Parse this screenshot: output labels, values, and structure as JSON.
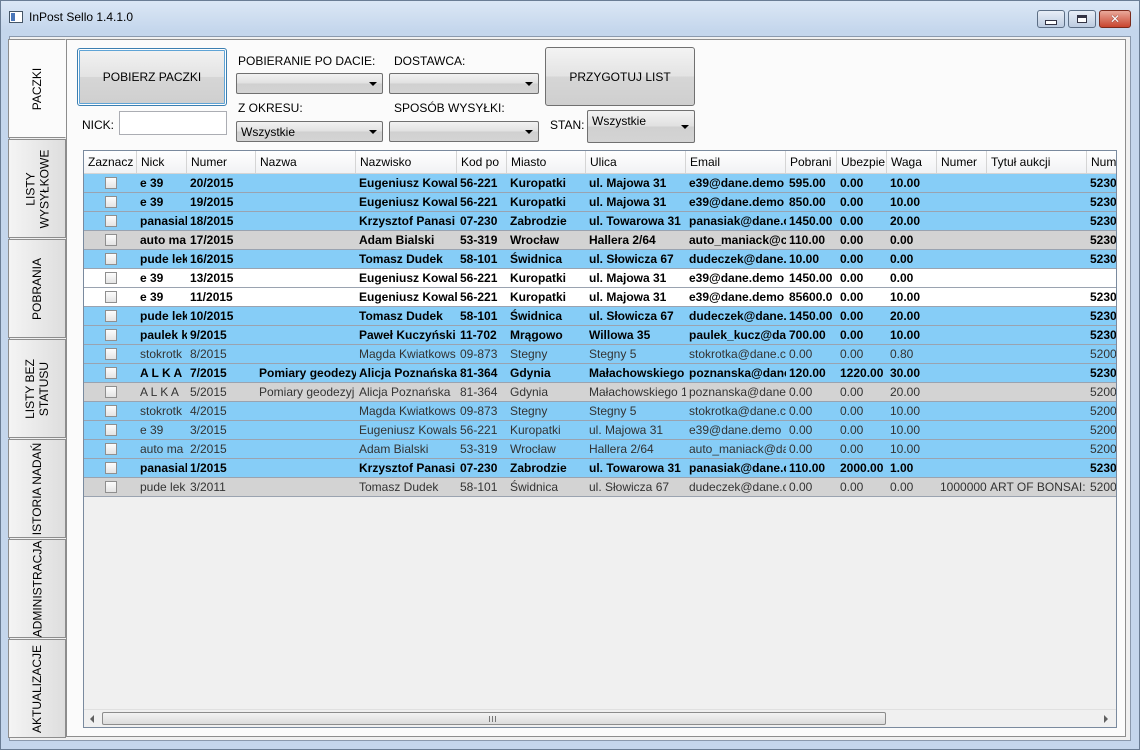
{
  "window": {
    "title": "InPost Sello 1.4.1.0"
  },
  "tabs": [
    {
      "label": "PACZKI",
      "active": true
    },
    {
      "label": "LISTY WYSYŁKOWE",
      "line1": "LISTY",
      "line2": "WYSYŁKOWE",
      "active": false
    },
    {
      "label": "POBRANIA",
      "active": false
    },
    {
      "label": "LISTY BEZ STATUSU",
      "line1": "LISTY BEZ",
      "line2": "STATUSU",
      "active": false
    },
    {
      "label": "ISTORIA NADAŃ",
      "active": false
    },
    {
      "label": "ADMINISTRACJA",
      "active": false
    },
    {
      "label": "AKTUALIZACJE",
      "active": false
    }
  ],
  "toolbar": {
    "fetch_button": "POBIERZ PACZKI",
    "nick_label": "NICK:",
    "nick_value": "",
    "date_label": "POBIERANIE PO DACIE:",
    "date_value": "",
    "period_label": "Z OKRESU:",
    "period_value": "Wszystkie",
    "supplier_label": "DOSTAWCA:",
    "supplier_value": "",
    "shipping_label": "SPOSÓB WYSYŁKI:",
    "shipping_value": "",
    "prepare_button": "PRZYGOTUJ LIST",
    "state_label": "STAN:",
    "state_value": "Wszystkie"
  },
  "colors": {
    "blue_row": "#86cdf7",
    "gray_row": "#d3d3d3",
    "white_row": "#ffffff"
  },
  "table": {
    "columns": [
      "Zaznacz",
      "Nick",
      "Numer",
      "Nazwa",
      "Nazwisko",
      "Kod po",
      "Miasto",
      "Ulica",
      "Email",
      "Pobrani",
      "Ubezpie",
      "Waga",
      "Numer",
      "Tytuł aukcji",
      "Num"
    ],
    "rows": [
      {
        "style": "blue",
        "bold": true,
        "cells": [
          "",
          "e 39",
          "20/2015",
          "",
          "Eugeniusz Kowal",
          "56-221",
          "Kuropatki",
          "ul. Majowa 31",
          "e39@dane.demo",
          "595.00",
          "0.00",
          "10.00",
          "",
          "",
          "5230"
        ]
      },
      {
        "style": "blue",
        "bold": true,
        "cells": [
          "",
          "e 39",
          "19/2015",
          "",
          "Eugeniusz Kowal",
          "56-221",
          "Kuropatki",
          "ul. Majowa 31",
          "e39@dane.demo",
          "850.00",
          "0.00",
          "10.00",
          "",
          "",
          "5230"
        ]
      },
      {
        "style": "blue",
        "bold": true,
        "cells": [
          "",
          "panasiak",
          "18/2015",
          "",
          "Krzysztof Panasi",
          "07-230",
          "Zabrodzie",
          "ul. Towarowa 31",
          "panasiak@dane.c",
          "1450.00",
          "0.00",
          "20.00",
          "",
          "",
          "5230"
        ]
      },
      {
        "style": "gray",
        "bold": true,
        "cells": [
          "",
          "auto ma",
          "17/2015",
          "",
          "Adam Bialski",
          "53-319",
          "Wrocław",
          "Hallera 2/64",
          "auto_maniack@c",
          "110.00",
          "0.00",
          "0.00",
          "",
          "",
          "5230"
        ]
      },
      {
        "style": "blue",
        "bold": true,
        "cells": [
          "",
          "pude lek",
          "16/2015",
          "",
          "Tomasz Dudek",
          "58-101",
          "Świdnica",
          "ul. Słowicza 67",
          "dudeczek@dane.",
          "10.00",
          "0.00",
          "0.00",
          "",
          "",
          "5230"
        ]
      },
      {
        "style": "white",
        "bold": true,
        "cells": [
          "",
          "e 39",
          "13/2015",
          "",
          "Eugeniusz Kowal",
          "56-221",
          "Kuropatki",
          "ul. Majowa 31",
          "e39@dane.demo",
          "1450.00",
          "0.00",
          "0.00",
          "",
          "",
          ""
        ]
      },
      {
        "style": "white",
        "bold": true,
        "cells": [
          "",
          "e 39",
          "11/2015",
          "",
          "Eugeniusz Kowal",
          "56-221",
          "Kuropatki",
          "ul. Majowa 31",
          "e39@dane.demo",
          "85600.0",
          "0.00",
          "10.00",
          "",
          "",
          "5230"
        ]
      },
      {
        "style": "blue",
        "bold": true,
        "cells": [
          "",
          "pude lek",
          "10/2015",
          "",
          "Tomasz Dudek",
          "58-101",
          "Świdnica",
          "ul. Słowicza 67",
          "dudeczek@dane.",
          "1450.00",
          "0.00",
          "20.00",
          "",
          "",
          "5230"
        ]
      },
      {
        "style": "blue",
        "bold": true,
        "cells": [
          "",
          "paulek k",
          "9/2015",
          "",
          "Paweł Kuczyński",
          "11-702",
          "Mrągowo",
          "Willowa 35",
          "paulek_kucz@da",
          "700.00",
          "0.00",
          "10.00",
          "",
          "",
          "5230"
        ]
      },
      {
        "style": "blue",
        "bold": false,
        "cells": [
          "",
          "stokrotk",
          "8/2015",
          "",
          "Magda Kwiatkows",
          "09-873",
          "Stegny",
          "Stegny 5",
          "stokrotka@dane.c",
          "0.00",
          "0.00",
          "0.80",
          "",
          "",
          "5200"
        ]
      },
      {
        "style": "blue",
        "bold": true,
        "cells": [
          "",
          "A L K A",
          "7/2015",
          "Pomiary geodezy",
          "Alicja Poznańska",
          "81-364",
          "Gdynia",
          "Małachowskiego",
          "poznanska@dane",
          "120.00",
          "1220.00",
          "30.00",
          "",
          "",
          "5230"
        ]
      },
      {
        "style": "gray",
        "bold": false,
        "cells": [
          "",
          "A L K A",
          "5/2015",
          "Pomiary geodezyj",
          "Alicja Poznańska",
          "81-364",
          "Gdynia",
          "Małachowskiego 1",
          "poznanska@dane",
          "0.00",
          "0.00",
          "20.00",
          "",
          "",
          "5200"
        ]
      },
      {
        "style": "blue",
        "bold": false,
        "cells": [
          "",
          "stokrotk",
          "4/2015",
          "",
          "Magda Kwiatkows",
          "09-873",
          "Stegny",
          "Stegny 5",
          "stokrotka@dane.c",
          "0.00",
          "0.00",
          "10.00",
          "",
          "",
          "5200"
        ]
      },
      {
        "style": "blue",
        "bold": false,
        "cells": [
          "",
          "e 39",
          "3/2015",
          "",
          "Eugeniusz Kowals",
          "56-221",
          "Kuropatki",
          "ul. Majowa 31",
          "e39@dane.demo",
          "0.00",
          "0.00",
          "10.00",
          "",
          "",
          "5200"
        ]
      },
      {
        "style": "blue",
        "bold": false,
        "cells": [
          "",
          "auto ma",
          "2/2015",
          "",
          "Adam Bialski",
          "53-319",
          "Wrocław",
          "Hallera 2/64",
          "auto_maniack@da",
          "0.00",
          "0.00",
          "10.00",
          "",
          "",
          "5200"
        ]
      },
      {
        "style": "blue",
        "bold": true,
        "cells": [
          "",
          "panasiak",
          "1/2015",
          "",
          "Krzysztof Panasi",
          "07-230",
          "Zabrodzie",
          "ul. Towarowa 31",
          "panasiak@dane.c",
          "110.00",
          "2000.00",
          "1.00",
          "",
          "",
          "5230"
        ]
      },
      {
        "style": "gray",
        "bold": false,
        "cells": [
          "",
          "pude lek",
          "3/2011",
          "",
          "Tomasz Dudek",
          "58-101",
          "Świdnica",
          "ul. Słowicza 67",
          "dudeczek@dane.c",
          "0.00",
          "0.00",
          "0.00",
          "1000000",
          "ART OF BONSAI: T",
          "5200"
        ]
      }
    ]
  }
}
